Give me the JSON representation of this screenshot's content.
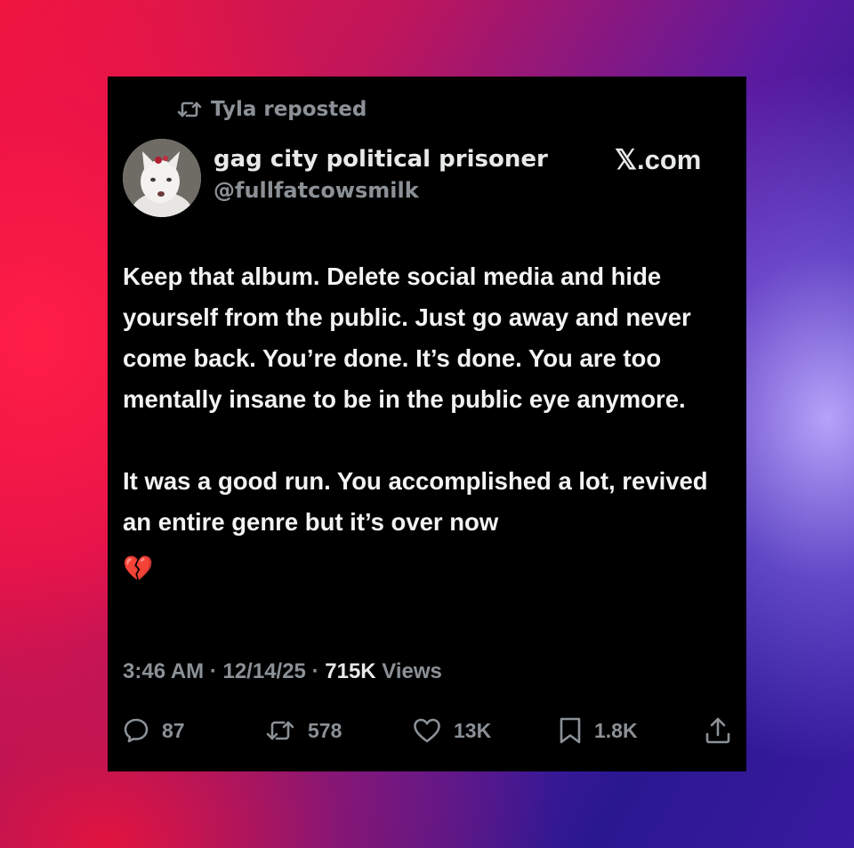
{
  "repost": {
    "label": "Tyla reposted",
    "icon": "repost-icon"
  },
  "author": {
    "display_name": "gag city political prisoner",
    "handle": "@fullfatcowsmilk",
    "avatar": "white-cat-avatar"
  },
  "brand": "𝕏.com",
  "tweet": {
    "paragraphs": [
      "Keep that album. Delete social media and hide yourself from the public. Just go away and never come back. You’re done. It’s done. You are too mentally insane to be in the public eye anymore.",
      "It was a good run. You accomplished a lot, revived an entire genre but it’s over now"
    ],
    "emoji": "💔"
  },
  "meta": {
    "time": "3:46 AM",
    "separator": "·",
    "date": "12/14/25",
    "views_count": "715K",
    "views_label": "Views"
  },
  "actions": {
    "replies": {
      "count": "87",
      "icon": "reply-icon"
    },
    "reposts": {
      "count": "578",
      "icon": "repost-icon"
    },
    "likes": {
      "count": "13K",
      "icon": "heart-icon"
    },
    "bookmarks": {
      "count": "1.8K",
      "icon": "bookmark-icon"
    },
    "share": {
      "icon": "share-icon"
    }
  },
  "colors": {
    "card_background": "#000000",
    "primary_text": "#e7e9ea",
    "secondary_text": "#8b9196"
  }
}
